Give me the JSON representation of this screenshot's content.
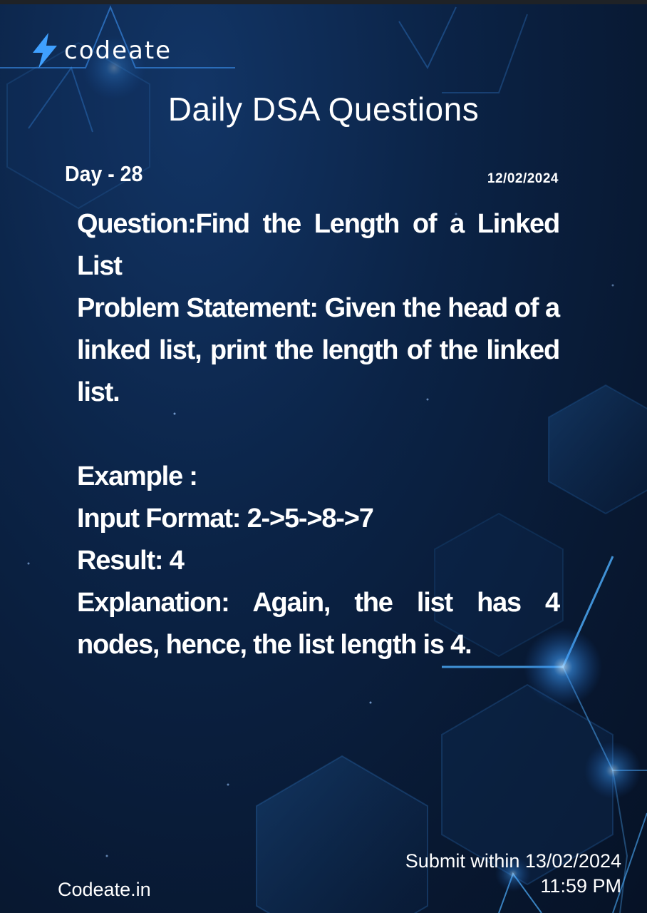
{
  "brand": {
    "name": "codeate",
    "icon": "lightning-bolt-icon",
    "accent": "#3fa0ff"
  },
  "title": "Daily DSA Questions",
  "day": "Day - 28",
  "date": "12/02/2024",
  "question": {
    "title_line": "Question:Find the Length of a Linked List",
    "problem_statement": "Problem Statement: Given the head of a linked list, print the length of the linked list."
  },
  "example": {
    "heading": "Example :",
    "input": "Input Format: 2->5->8->7",
    "result": "Result: 4",
    "explanation": "Explanation: Again, the list has 4 nodes, hence, the list length is 4."
  },
  "submit": {
    "line1": "Submit within 13/02/2024",
    "line2": "11:59 PM"
  },
  "footer": {
    "site": "Codeate.in"
  },
  "colors": {
    "background": "#0b2346",
    "glow": "#2f8bff",
    "text": "#ffffff"
  }
}
